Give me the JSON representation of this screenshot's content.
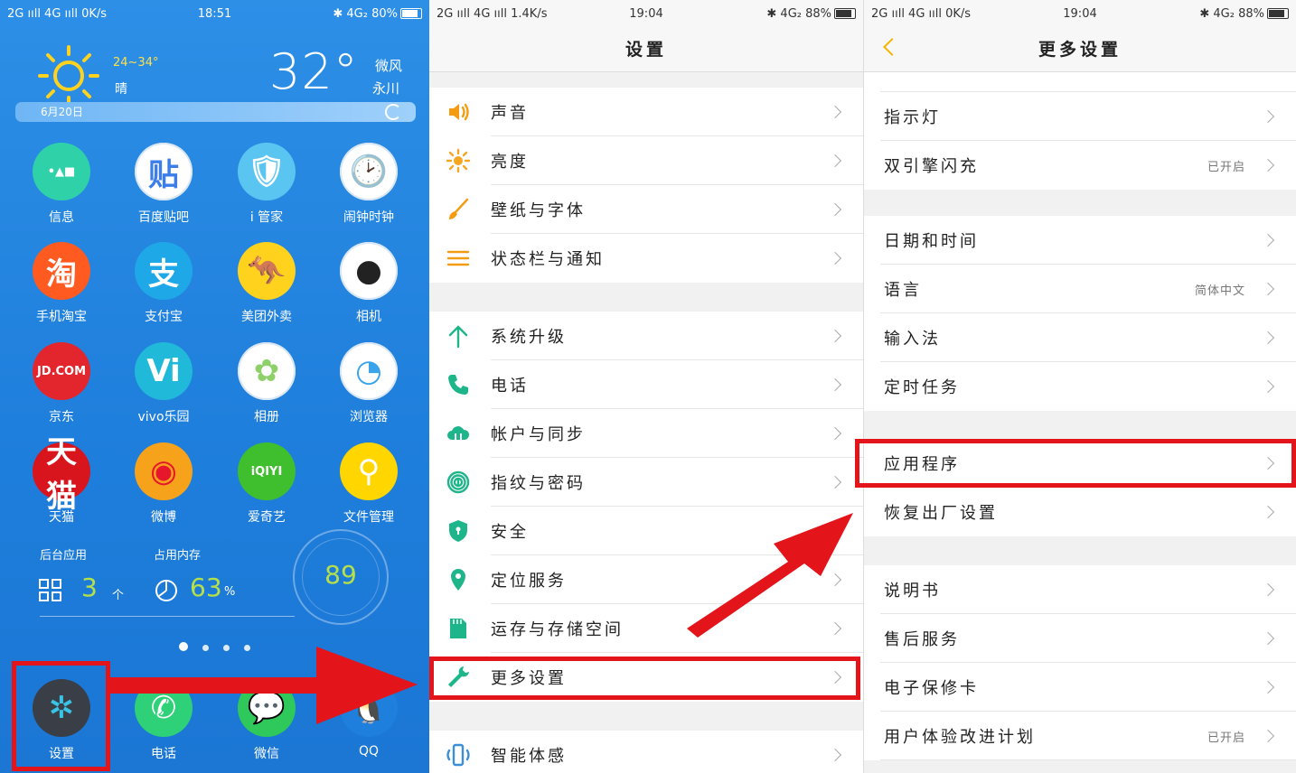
{
  "home": {
    "status": {
      "left": "2G ııll 4G ııll 0K/s",
      "time": "18:51",
      "right": "✱ 4G₂ 80%"
    },
    "weather": {
      "range": "24~34°",
      "condition": "晴",
      "temp": "32°",
      "wind": "微风",
      "city": "永川",
      "date": "6月20日"
    },
    "apps": [
      {
        "label": "信息",
        "color": "#2fd1a9",
        "glyph": "•▲■",
        "fg": "#fff"
      },
      {
        "label": "百度贴吧",
        "color": "#ffffff",
        "glyph": "贴",
        "fg": "#3b7de9"
      },
      {
        "label": "i 管家",
        "color": "#5bc5f2",
        "glyph": "🛡",
        "fg": "#fff"
      },
      {
        "label": "闹钟时钟",
        "color": "#ffffff",
        "glyph": "🕑",
        "fg": "#333"
      },
      {
        "label": "手机淘宝",
        "color": "#ff5a1f",
        "glyph": "淘",
        "fg": "#fff"
      },
      {
        "label": "支付宝",
        "color": "#1fa8e8",
        "glyph": "支",
        "fg": "#fff"
      },
      {
        "label": "美团外卖",
        "color": "#ffd21e",
        "glyph": "🦘",
        "fg": "#333"
      },
      {
        "label": "相机",
        "color": "#ffffff",
        "glyph": "●",
        "fg": "#222"
      },
      {
        "label": "京东",
        "color": "#e3262d",
        "glyph": "JD.COM",
        "fg": "#fff"
      },
      {
        "label": "vivo乐园",
        "color": "#20b9d9",
        "glyph": "Vi",
        "fg": "#fff"
      },
      {
        "label": "相册",
        "color": "#ffffff",
        "glyph": "✿",
        "fg": "#8ed16a"
      },
      {
        "label": "浏览器",
        "color": "#ffffff",
        "glyph": "◔",
        "fg": "#3aa3ea"
      },
      {
        "label": "天猫",
        "color": "#d8151c",
        "glyph": "天猫",
        "fg": "#fff"
      },
      {
        "label": "微博",
        "color": "#f7a21b",
        "glyph": "◉",
        "fg": "#e6162d"
      },
      {
        "label": "爱奇艺",
        "color": "#3fbf2e",
        "glyph": "iQIYI",
        "fg": "#fff"
      },
      {
        "label": "文件管理",
        "color": "#ffd600",
        "glyph": "⚲",
        "fg": "#fff"
      }
    ],
    "widget": {
      "bg_label": "后台应用",
      "bg_count": "3",
      "bg_unit": "个",
      "mem_label": "占用内存",
      "mem_value": "63",
      "mem_unit": "%",
      "score": "89"
    },
    "dock": [
      {
        "label": "设置",
        "color": "#3a3f47",
        "glyph": "✲",
        "fg": "#39c3e6"
      },
      {
        "label": "电话",
        "color": "#2fd178",
        "glyph": "✆",
        "fg": "#fff"
      },
      {
        "label": "微信",
        "color": "#2fc85a",
        "glyph": "💬",
        "fg": "#fff"
      },
      {
        "label": "QQ",
        "color": "#1f7fdc",
        "glyph": "🐧",
        "fg": "#fff"
      }
    ]
  },
  "settings": {
    "status": {
      "left": "2G ııll 4G ııll 1.4K/s",
      "time": "19:04",
      "right": "✱ 4G₂ 88%"
    },
    "title": "设置",
    "items": [
      {
        "label": "声音",
        "icon": "speaker-icon",
        "color": "#f39c12"
      },
      {
        "label": "亮度",
        "icon": "sun-icon",
        "color": "#f5a623"
      },
      {
        "label": "壁纸与字体",
        "icon": "brush-icon",
        "color": "#f39c12"
      },
      {
        "label": "状态栏与通知",
        "icon": "lines-icon",
        "color": "#f39c12"
      },
      {
        "label": "系统升级",
        "icon": "up-arrow-icon",
        "color": "#1fb58a"
      },
      {
        "label": "电话",
        "icon": "phone-icon",
        "color": "#1fb58a"
      },
      {
        "label": "帐户与同步",
        "icon": "cloud-icon",
        "color": "#1fb58a"
      },
      {
        "label": "指纹与密码",
        "icon": "fingerprint-icon",
        "color": "#1fb58a"
      },
      {
        "label": "安全",
        "icon": "shield-icon",
        "color": "#1fb58a"
      },
      {
        "label": "定位服务",
        "icon": "location-icon",
        "color": "#1fb58a"
      },
      {
        "label": "运存与存储空间",
        "icon": "sdcard-icon",
        "color": "#1fb58a"
      },
      {
        "label": "更多设置",
        "icon": "wrench-icon",
        "color": "#1fb58a"
      },
      {
        "label": "智能体感",
        "icon": "phone-gesture-icon",
        "color": "#3a8fd8"
      }
    ]
  },
  "more": {
    "status": {
      "left": "2G ııll 4G ııll 0K/s",
      "time": "19:04",
      "right": "✱ 4G₂ 88%"
    },
    "title": "更多设置",
    "items": [
      {
        "label": "指示灯",
        "value": ""
      },
      {
        "label": "双引擎闪充",
        "value": "已开启"
      },
      {
        "label": "日期和时间",
        "value": ""
      },
      {
        "label": "语言",
        "value": "简体中文"
      },
      {
        "label": "输入法",
        "value": ""
      },
      {
        "label": "定时任务",
        "value": ""
      },
      {
        "label": "应用程序",
        "value": ""
      },
      {
        "label": "恢复出厂设置",
        "value": ""
      },
      {
        "label": "说明书",
        "value": ""
      },
      {
        "label": "售后服务",
        "value": ""
      },
      {
        "label": "电子保修卡",
        "value": ""
      },
      {
        "label": "用户体验改进计划",
        "value": "已开启"
      }
    ]
  },
  "annotation_color": "#e4141b"
}
